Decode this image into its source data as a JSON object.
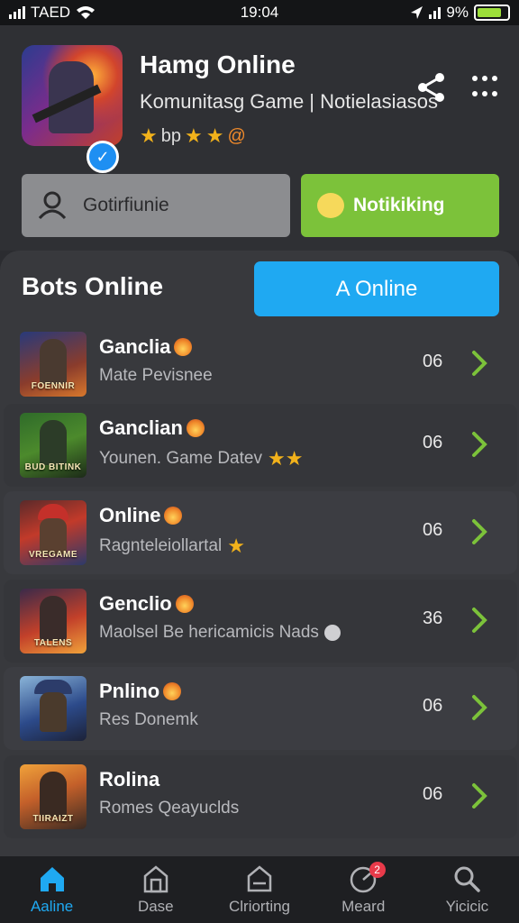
{
  "status_bar": {
    "carrier": "TAED",
    "time": "19:04",
    "battery": "9%"
  },
  "header": {
    "app_title": "Hamg Online",
    "app_subtitle": "Komunitasg Game | Notielasiasos",
    "rating_text": "bp",
    "left_button_label": "Gotirfiunie",
    "right_button_label": "Notikiking"
  },
  "panel": {
    "title": "Bots Online",
    "online_button_label": "A Online",
    "rows": [
      {
        "name": "Ganclia",
        "sub": "Mate Pevisnee",
        "count": "06",
        "thumb_label": "FOENNIR",
        "sub_icon": ""
      },
      {
        "name": "Ganclian",
        "sub": "Younen. Game Datev",
        "count": "06",
        "thumb_label": "BUD BITINK",
        "sub_icon": "★★"
      },
      {
        "name": "Online",
        "sub": "Ragnteleiollartal",
        "count": "06",
        "thumb_label": "VREGAME",
        "sub_icon": "★"
      },
      {
        "name": "Genclio",
        "sub": "Maolsel Be hericamicis Nads",
        "count": "36",
        "thumb_label": "TALENS",
        "sub_icon": "skull"
      },
      {
        "name": "Pnlino",
        "sub": "Res Donemk",
        "count": "06",
        "thumb_label": "",
        "sub_icon": ""
      },
      {
        "name": "Rolina",
        "sub": "Romes Qeayuclds",
        "count": "06",
        "thumb_label": "TIIRAIZT",
        "sub_icon": ""
      }
    ]
  },
  "bottom_nav": {
    "items": [
      {
        "label": "Aaline",
        "icon": "home-icon"
      },
      {
        "label": "Dase",
        "icon": "store-icon"
      },
      {
        "label": "Clriorting",
        "icon": "chat-icon"
      },
      {
        "label": "Meard",
        "icon": "clock-icon",
        "badge": "2"
      },
      {
        "label": "Yicicic",
        "icon": "search-icon"
      }
    ]
  },
  "colors": {
    "accent_blue": "#1fa9f2",
    "accent_green": "#7cc23a",
    "chevron_green": "#7cc23a"
  }
}
